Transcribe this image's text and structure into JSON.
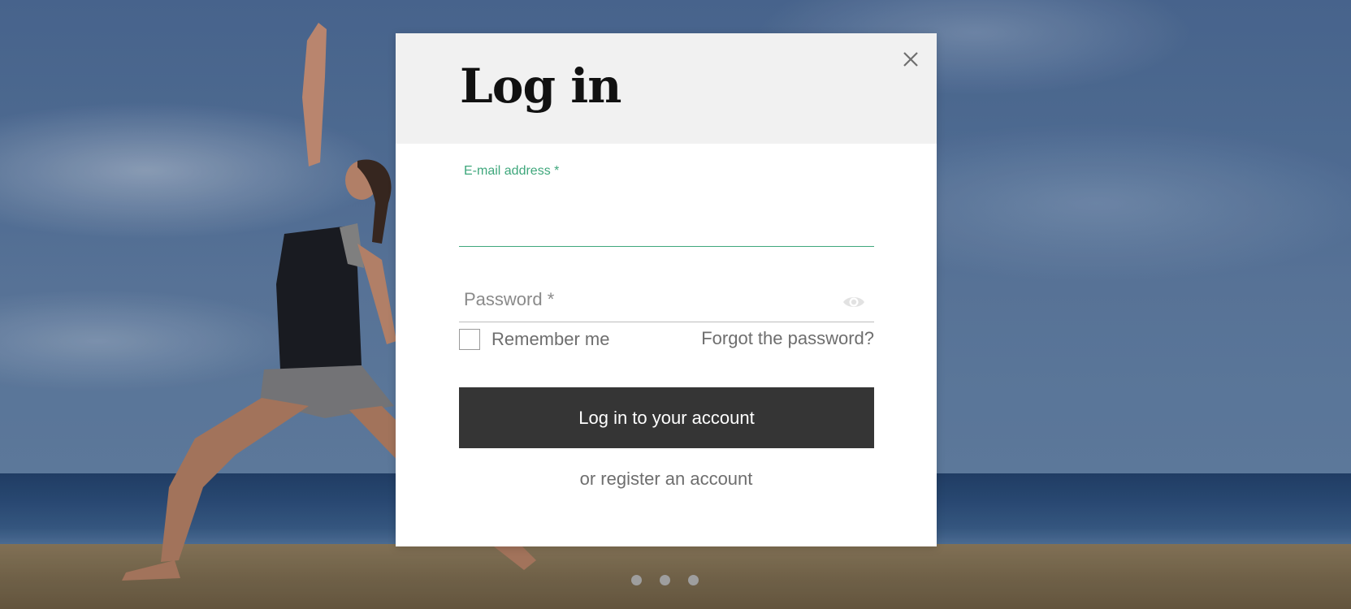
{
  "modal": {
    "title": "Log in",
    "email": {
      "label": "E-mail address *",
      "value": ""
    },
    "password": {
      "placeholder": "Password *",
      "value": ""
    },
    "remember_label": "Remember me",
    "remember_checked": false,
    "forgot_label": "Forgot the password?",
    "submit_label": "Log in to your account",
    "register_label": "or register an account"
  },
  "icons": {
    "close": "close-icon",
    "password_visibility": "eye-icon"
  },
  "carousel": {
    "dot_count": 3
  },
  "colors": {
    "accent": "#3fa77c",
    "button": "#353535",
    "header_bg": "#f1f1f1"
  }
}
